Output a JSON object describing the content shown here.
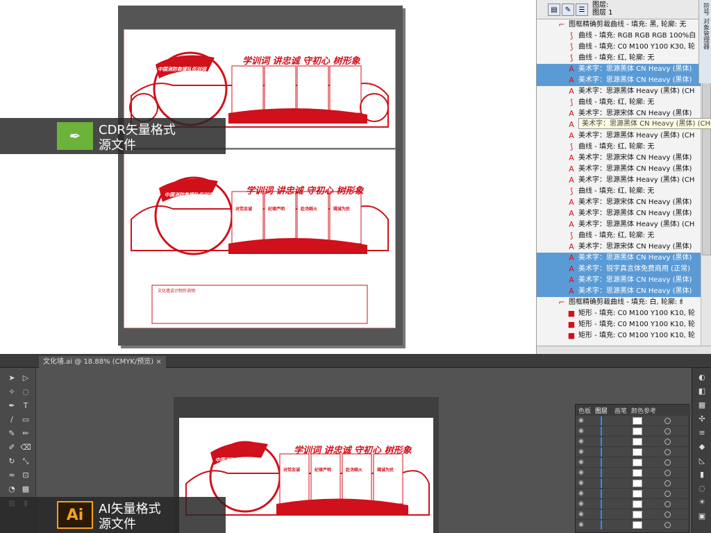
{
  "cdr": {
    "badge_line1": "CDR矢量格式",
    "badge_line2": "源文件",
    "title_top": "学训词 讲忠诚 守初心 树形象",
    "title_mid": "学训词 讲忠诚 守初心 树形象",
    "org_name_top": "中国消防救援队伍训词",
    "org_name_mid": "中国消防救援队伍训词",
    "mid_cards": [
      "对党忠诚",
      "纪律严明",
      "赴汤蹈火",
      "竭诚为民"
    ],
    "notes_title": "文化墙设计制作说明",
    "colors": {
      "accent": "#d0101a",
      "selected": "#5b9bd5"
    }
  },
  "layers_panel": {
    "header_line1": "图层:",
    "header_line2": "图层 1",
    "side_tab_1": "符号",
    "side_tab_2": "对象管理器",
    "tooltip": "美术字：思源黑体 CN Heavy (黑体) (CHC)",
    "rows": [
      {
        "icon": "frame",
        "text": "图框精确剪裁曲线 - 填充: 黑, 轮廓: 无",
        "selected": false,
        "level": 0
      },
      {
        "icon": "curve",
        "text": "曲线 - 填充: RGB RGB RGB 100%白",
        "selected": false,
        "level": 1
      },
      {
        "icon": "curve",
        "text": "曲线 - 填充: C0 M100 Y100 K30, 轮",
        "selected": false,
        "level": 1
      },
      {
        "icon": "curve",
        "text": "曲线 - 填充: 红, 轮廓: 无",
        "selected": false,
        "level": 1
      },
      {
        "icon": "text",
        "text": "美术字：思源黑体 CN Heavy (黑体)",
        "selected": true,
        "level": 1
      },
      {
        "icon": "text",
        "text": "美术字：思源黑体 CN Heavy (黑体)",
        "selected": true,
        "level": 1
      },
      {
        "icon": "text",
        "text": "美术字：思源黑体 Heavy (黑体) (CH",
        "selected": false,
        "level": 1
      },
      {
        "icon": "curve",
        "text": "曲线 - 填充: 红, 轮廓: 无",
        "selected": false,
        "level": 1
      },
      {
        "icon": "text",
        "text": "美术字：思源宋体 CN Heavy (黑体)",
        "selected": false,
        "level": 1
      },
      {
        "icon": "text",
        "text": "美术字：思源黑体 CN Heavy (黑体)",
        "selected": false,
        "level": 1
      },
      {
        "icon": "text",
        "text": "美术字：思源黑体 Heavy (黑体) (CH",
        "selected": false,
        "level": 1
      },
      {
        "icon": "curve",
        "text": "曲线 - 填充: 红, 轮廓: 无",
        "selected": false,
        "level": 1
      },
      {
        "icon": "text",
        "text": "美术字：思源宋体 CN Heavy (黑体)",
        "selected": false,
        "level": 1
      },
      {
        "icon": "text",
        "text": "美术字：思源黑体 CN Heavy (黑体)",
        "selected": false,
        "level": 1
      },
      {
        "icon": "text",
        "text": "美术字：思源黑体 Heavy (黑体) (CH",
        "selected": false,
        "level": 1
      },
      {
        "icon": "curve",
        "text": "曲线 - 填充: 红, 轮廓: 无",
        "selected": false,
        "level": 1
      },
      {
        "icon": "text",
        "text": "美术字：思源宋体 CN Heavy (黑体)",
        "selected": false,
        "level": 1
      },
      {
        "icon": "text",
        "text": "美术字：思源黑体 CN Heavy (黑体)",
        "selected": false,
        "level": 1
      },
      {
        "icon": "text",
        "text": "美术字：思源黑体 Heavy (黑体) (CH",
        "selected": false,
        "level": 1
      },
      {
        "icon": "curve",
        "text": "曲线 - 填充: 红, 轮廓: 无",
        "selected": false,
        "level": 1
      },
      {
        "icon": "text",
        "text": "美术字：思源宋体 CN Heavy (黑体)",
        "selected": false,
        "level": 1
      },
      {
        "icon": "text",
        "text": "美术字：思源黑体 CN Heavy (黑体)",
        "selected": true,
        "level": 1
      },
      {
        "icon": "text",
        "text": "美术字：锐字真言体免费商用 (正常)",
        "selected": true,
        "level": 1
      },
      {
        "icon": "text",
        "text": "美术字：思源黑体 CN Heavy (黑体)",
        "selected": true,
        "level": 1
      },
      {
        "icon": "text",
        "text": "美术字：思源黑体 CN Heavy (黑体)",
        "selected": true,
        "level": 1
      },
      {
        "icon": "frame",
        "text": "图框精确剪裁曲线 - 填充: 白, 轮廓: 纟",
        "selected": false,
        "level": 0
      },
      {
        "icon": "rect",
        "text": "矩形 - 填充: C0 M100 Y100 K10, 轮",
        "selected": false,
        "level": 1
      },
      {
        "icon": "rect",
        "text": "矩形 - 填充: C0 M100 Y100 K10, 轮",
        "selected": false,
        "level": 1
      },
      {
        "icon": "rect",
        "text": "矩形 - 填充: C0 M100 Y100 K10, 轮",
        "selected": false,
        "level": 1
      }
    ]
  },
  "ai": {
    "doc_tab": "文化墙.ai @ 18.88% (CMYK/预览)",
    "badge_line1": "AI矢量格式",
    "badge_line2": "源文件",
    "logo": "Ai",
    "title": "学训词 讲忠诚 守初心 树形象",
    "org_name": "中国消防救援队伍训词",
    "cards": [
      "对党忠诚",
      "纪律严明",
      "赴汤蹈火",
      "竭诚为民"
    ],
    "layers_tabs": [
      "色板",
      "图层",
      "画笔",
      "颜色参考"
    ]
  }
}
